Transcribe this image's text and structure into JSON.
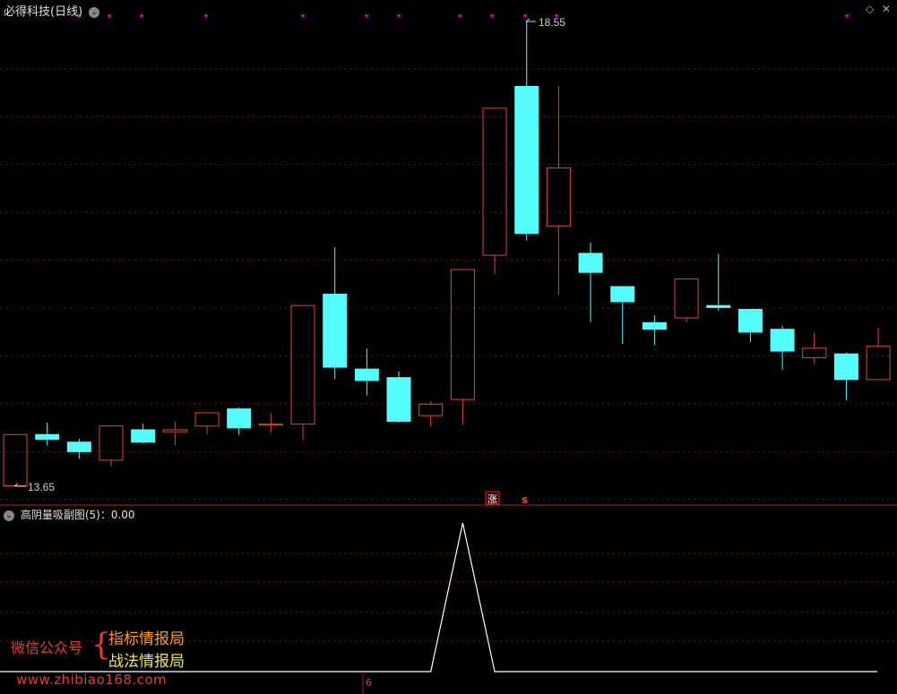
{
  "window": {
    "stock_title": "必得科技(日线)",
    "indicator_title": "高阴量吸副图(5)：0.00",
    "axis_marker": "6"
  },
  "annotations": {
    "zhang_label": "涨",
    "s_label": "s",
    "high_label": "18.55",
    "low_label": "13.65"
  },
  "watermark": {
    "left": "微信公众号",
    "line1": "指标情报局",
    "line2": "战法情报局",
    "url": "www.zhibiao168.com"
  },
  "colors": {
    "up": "#e2433b",
    "down": "#54fcfc",
    "grid": "#7a1212",
    "divider": "#b41818",
    "indicator_line": "#ffffff",
    "marker_dot": "#d800d8"
  },
  "chart_data": [
    {
      "type": "candlestick",
      "title": "必得科技(日线)",
      "ylim": [
        13.5,
        18.8
      ],
      "grid": true,
      "candles": [
        {
          "open": 13.65,
          "close": 14.2,
          "high": 14.2,
          "low": 13.65
        },
        {
          "open": 14.2,
          "close": 14.14,
          "high": 14.32,
          "low": 14.08
        },
        {
          "open": 14.12,
          "close": 14.01,
          "high": 14.15,
          "low": 13.94
        },
        {
          "open": 13.92,
          "close": 14.29,
          "high": 14.29,
          "low": 13.86
        },
        {
          "open": 14.25,
          "close": 14.11,
          "high": 14.31,
          "low": 14.1
        },
        {
          "open": 14.22,
          "close": 14.25,
          "high": 14.33,
          "low": 14.08
        },
        {
          "open": 14.28,
          "close": 14.43,
          "high": 14.43,
          "low": 14.2
        },
        {
          "open": 14.47,
          "close": 14.26,
          "high": 14.48,
          "low": 14.19
        },
        {
          "open": 14.29,
          "close": 14.31,
          "high": 14.42,
          "low": 14.22
        },
        {
          "open": 14.3,
          "close": 15.56,
          "high": 15.56,
          "low": 14.14
        },
        {
          "open": 15.68,
          "close": 14.9,
          "high": 16.17,
          "low": 14.78
        },
        {
          "open": 14.89,
          "close": 14.76,
          "high": 15.1,
          "low": 14.61
        },
        {
          "open": 14.8,
          "close": 14.33,
          "high": 14.86,
          "low": 14.32
        },
        {
          "open": 14.39,
          "close": 14.52,
          "high": 14.55,
          "low": 14.28
        },
        {
          "open": 14.56,
          "close": 15.94,
          "high": 15.94,
          "low": 14.3
        },
        {
          "open": 16.08,
          "close": 17.64,
          "high": 17.64,
          "low": 15.89
        },
        {
          "open": 17.87,
          "close": 16.31,
          "high": 18.55,
          "low": 16.24
        },
        {
          "open": 16.39,
          "close": 17.01,
          "high": 17.87,
          "low": 15.67
        },
        {
          "open": 16.11,
          "close": 15.9,
          "high": 16.22,
          "low": 15.38
        },
        {
          "open": 15.76,
          "close": 15.59,
          "high": 15.76,
          "low": 15.15
        },
        {
          "open": 15.38,
          "close": 15.3,
          "high": 15.45,
          "low": 15.14
        },
        {
          "open": 15.42,
          "close": 15.84,
          "high": 15.84,
          "low": 15.38
        },
        {
          "open": 15.56,
          "close": 15.53,
          "high": 16.1,
          "low": 15.5
        },
        {
          "open": 15.52,
          "close": 15.27,
          "high": 15.52,
          "low": 15.17
        },
        {
          "open": 15.31,
          "close": 15.07,
          "high": 15.34,
          "low": 14.88
        },
        {
          "open": 15.0,
          "close": 15.11,
          "high": 15.27,
          "low": 14.94
        },
        {
          "open": 15.05,
          "close": 14.77,
          "high": 15.06,
          "low": 14.56
        },
        {
          "open": 14.77,
          "close": 15.13,
          "high": 15.32,
          "low": 14.77
        }
      ]
    },
    {
      "type": "line",
      "title": "高阴量吸副图(5)",
      "ylim": [
        0,
        1
      ],
      "series": [
        {
          "values": [
            0,
            0,
            0,
            0,
            0,
            0,
            0,
            0,
            0,
            0,
            0,
            0,
            0,
            0,
            1,
            0,
            0,
            0,
            0,
            0,
            0,
            0,
            0,
            0,
            0,
            0,
            0,
            0
          ]
        }
      ]
    }
  ]
}
